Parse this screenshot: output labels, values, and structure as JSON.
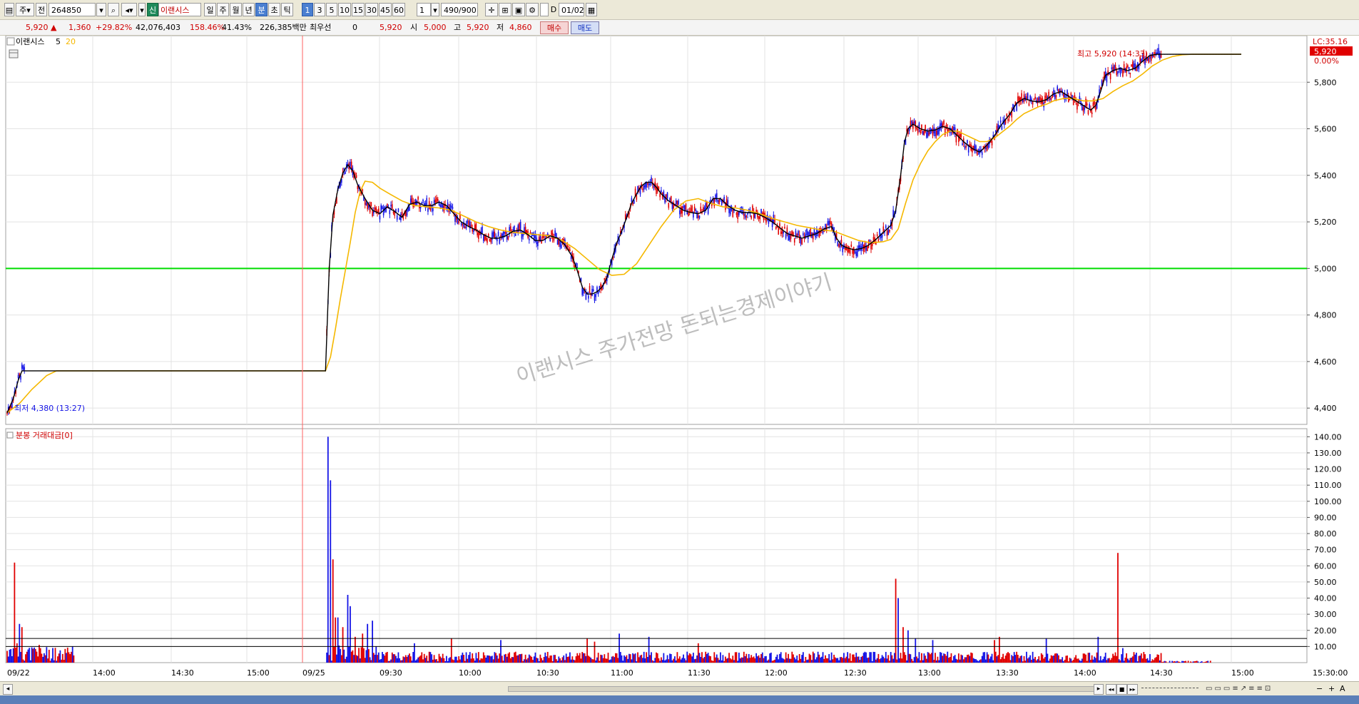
{
  "toolbar": {
    "market": "주",
    "market_mode": "전",
    "code": "264850",
    "badge": "신",
    "name": "이랜시스",
    "periods": [
      "일",
      "주",
      "월",
      "년",
      "분",
      "초",
      "틱"
    ],
    "active_period": "분",
    "intervals": [
      "1",
      "3",
      "5",
      "10",
      "15",
      "30",
      "45",
      "60"
    ],
    "active_interval": "1",
    "step": "1",
    "count": "490",
    "count_total": "900",
    "d_label": "D",
    "date": "01/02"
  },
  "quote": {
    "price": "5,920",
    "change": "1,360",
    "change_pct": "+29.82%",
    "volume": "42,076,403",
    "vol_ratio": "158.46%",
    "turnover": "41.43%",
    "amount": "226,385백만",
    "priority_label": "최우선",
    "priority_qty": "0",
    "priority_price": "5,920",
    "open_label": "시",
    "open": "5,000",
    "high_label": "고",
    "high": "5,920",
    "low_label": "저",
    "low": "4,860",
    "buy_label": "매수",
    "sell_label": "매도"
  },
  "chart_data": [
    {
      "type": "line",
      "legend": "이랜시스",
      "ma_periods": [
        "5",
        "20"
      ],
      "colors": {
        "ma5": "#000000",
        "ma20": "#f5b800",
        "up": "#e00000",
        "down": "#1414e6",
        "ref_line": "#00dd00"
      },
      "reference_line": 5000,
      "ylim": [
        4330,
        6000
      ],
      "yticks": [
        "4,400",
        "4,600",
        "4,800",
        "5,000",
        "5,200",
        "5,400",
        "5,600",
        "5,800"
      ],
      "x_labels": [
        "09/22",
        "14:00",
        "14:30",
        "15:00",
        "09/25",
        "09:30",
        "10:00",
        "10:30",
        "11:00",
        "11:30",
        "12:00",
        "12:30",
        "13:00",
        "13:30",
        "14:00",
        "14:30",
        "15:00",
        "15:30:00"
      ],
      "ma5": [
        [
          0,
          4380
        ],
        [
          5,
          4440
        ],
        [
          9,
          4520
        ],
        [
          12,
          4560
        ],
        [
          20,
          4560
        ],
        [
          40,
          4560
        ],
        [
          100,
          4560
        ],
        [
          180,
          4560
        ],
        [
          220,
          4560
        ],
        [
          258,
          4560
        ],
        [
          261,
          5000
        ],
        [
          264,
          5230
        ],
        [
          268,
          5340
        ],
        [
          272,
          5410
        ],
        [
          276,
          5445
        ],
        [
          280,
          5420
        ],
        [
          284,
          5360
        ],
        [
          290,
          5300
        ],
        [
          296,
          5250
        ],
        [
          302,
          5235
        ],
        [
          308,
          5265
        ],
        [
          314,
          5245
        ],
        [
          320,
          5220
        ],
        [
          326,
          5275
        ],
        [
          332,
          5285
        ],
        [
          338,
          5270
        ],
        [
          344,
          5270
        ],
        [
          350,
          5285
        ],
        [
          356,
          5270
        ],
        [
          362,
          5235
        ],
        [
          368,
          5200
        ],
        [
          374,
          5180
        ],
        [
          380,
          5165
        ],
        [
          386,
          5145
        ],
        [
          392,
          5130
        ],
        [
          398,
          5130
        ],
        [
          404,
          5140
        ],
        [
          410,
          5160
        ],
        [
          416,
          5165
        ],
        [
          422,
          5145
        ],
        [
          428,
          5120
        ],
        [
          434,
          5120
        ],
        [
          440,
          5140
        ],
        [
          446,
          5130
        ],
        [
          452,
          5100
        ],
        [
          458,
          5050
        ],
        [
          462,
          4990
        ],
        [
          466,
          4920
        ],
        [
          470,
          4890
        ],
        [
          474,
          4890
        ],
        [
          478,
          4900
        ],
        [
          482,
          4920
        ],
        [
          486,
          4960
        ],
        [
          490,
          5040
        ],
        [
          494,
          5110
        ],
        [
          498,
          5160
        ],
        [
          502,
          5220
        ],
        [
          506,
          5280
        ],
        [
          510,
          5320
        ],
        [
          514,
          5355
        ],
        [
          518,
          5370
        ],
        [
          522,
          5370
        ],
        [
          526,
          5350
        ],
        [
          530,
          5320
        ],
        [
          536,
          5290
        ],
        [
          542,
          5270
        ],
        [
          548,
          5250
        ],
        [
          554,
          5240
        ],
        [
          560,
          5235
        ],
        [
          566,
          5250
        ],
        [
          572,
          5300
        ],
        [
          578,
          5300
        ],
        [
          584,
          5270
        ],
        [
          590,
          5250
        ],
        [
          596,
          5240
        ],
        [
          602,
          5240
        ],
        [
          608,
          5235
        ],
        [
          614,
          5220
        ],
        [
          620,
          5200
        ],
        [
          626,
          5175
        ],
        [
          632,
          5150
        ],
        [
          638,
          5140
        ],
        [
          644,
          5130
        ],
        [
          650,
          5140
        ],
        [
          656,
          5150
        ],
        [
          662,
          5170
        ],
        [
          668,
          5180
        ],
        [
          672,
          5130
        ],
        [
          676,
          5100
        ],
        [
          680,
          5090
        ],
        [
          686,
          5080
        ],
        [
          692,
          5085
        ],
        [
          698,
          5100
        ],
        [
          704,
          5125
        ],
        [
          710,
          5155
        ],
        [
          716,
          5185
        ],
        [
          720,
          5250
        ],
        [
          724,
          5400
        ],
        [
          727,
          5540
        ],
        [
          730,
          5600
        ],
        [
          734,
          5620
        ],
        [
          740,
          5600
        ],
        [
          746,
          5590
        ],
        [
          752,
          5595
        ],
        [
          758,
          5610
        ],
        [
          764,
          5600
        ],
        [
          770,
          5570
        ],
        [
          776,
          5540
        ],
        [
          782,
          5515
        ],
        [
          788,
          5500
        ],
        [
          794,
          5530
        ],
        [
          800,
          5570
        ],
        [
          806,
          5620
        ],
        [
          812,
          5660
        ],
        [
          818,
          5710
        ],
        [
          824,
          5730
        ],
        [
          830,
          5720
        ],
        [
          836,
          5715
        ],
        [
          842,
          5725
        ],
        [
          848,
          5750
        ],
        [
          854,
          5760
        ],
        [
          860,
          5740
        ],
        [
          866,
          5720
        ],
        [
          872,
          5700
        ],
        [
          878,
          5680
        ],
        [
          882,
          5700
        ],
        [
          886,
          5760
        ],
        [
          890,
          5830
        ],
        [
          896,
          5850
        ],
        [
          902,
          5860
        ],
        [
          908,
          5850
        ],
        [
          914,
          5860
        ],
        [
          920,
          5890
        ],
        [
          926,
          5915
        ],
        [
          932,
          5920
        ],
        [
          960,
          5920
        ],
        [
          1000,
          5920
        ]
      ],
      "ma20": [
        [
          0,
          4380
        ],
        [
          10,
          4420
        ],
        [
          20,
          4480
        ],
        [
          32,
          4540
        ],
        [
          40,
          4560
        ],
        [
          100,
          4560
        ],
        [
          258,
          4560
        ],
        [
          262,
          4620
        ],
        [
          266,
          4740
        ],
        [
          270,
          4870
        ],
        [
          274,
          4990
        ],
        [
          278,
          5110
        ],
        [
          282,
          5240
        ],
        [
          286,
          5330
        ],
        [
          290,
          5375
        ],
        [
          296,
          5370
        ],
        [
          302,
          5345
        ],
        [
          310,
          5320
        ],
        [
          320,
          5290
        ],
        [
          330,
          5270
        ],
        [
          340,
          5265
        ],
        [
          350,
          5260
        ],
        [
          360,
          5250
        ],
        [
          370,
          5225
        ],
        [
          380,
          5200
        ],
        [
          390,
          5180
        ],
        [
          400,
          5165
        ],
        [
          410,
          5155
        ],
        [
          420,
          5150
        ],
        [
          430,
          5145
        ],
        [
          440,
          5140
        ],
        [
          450,
          5120
        ],
        [
          460,
          5085
        ],
        [
          470,
          5040
        ],
        [
          480,
          4995
        ],
        [
          490,
          4970
        ],
        [
          500,
          4975
        ],
        [
          510,
          5020
        ],
        [
          520,
          5100
        ],
        [
          530,
          5180
        ],
        [
          540,
          5250
        ],
        [
          550,
          5290
        ],
        [
          560,
          5300
        ],
        [
          570,
          5280
        ],
        [
          580,
          5265
        ],
        [
          590,
          5260
        ],
        [
          600,
          5250
        ],
        [
          610,
          5235
        ],
        [
          620,
          5215
        ],
        [
          630,
          5200
        ],
        [
          640,
          5185
        ],
        [
          650,
          5175
        ],
        [
          660,
          5165
        ],
        [
          670,
          5160
        ],
        [
          680,
          5140
        ],
        [
          690,
          5120
        ],
        [
          700,
          5110
        ],
        [
          710,
          5115
        ],
        [
          716,
          5125
        ],
        [
          722,
          5170
        ],
        [
          728,
          5280
        ],
        [
          734,
          5380
        ],
        [
          740,
          5450
        ],
        [
          746,
          5505
        ],
        [
          752,
          5545
        ],
        [
          758,
          5575
        ],
        [
          764,
          5590
        ],
        [
          770,
          5590
        ],
        [
          776,
          5575
        ],
        [
          782,
          5560
        ],
        [
          788,
          5545
        ],
        [
          794,
          5545
        ],
        [
          800,
          5560
        ],
        [
          806,
          5585
        ],
        [
          812,
          5610
        ],
        [
          818,
          5640
        ],
        [
          824,
          5665
        ],
        [
          830,
          5680
        ],
        [
          836,
          5695
        ],
        [
          842,
          5705
        ],
        [
          848,
          5720
        ],
        [
          856,
          5730
        ],
        [
          864,
          5730
        ],
        [
          872,
          5720
        ],
        [
          880,
          5720
        ],
        [
          888,
          5730
        ],
        [
          896,
          5760
        ],
        [
          904,
          5785
        ],
        [
          912,
          5805
        ],
        [
          920,
          5835
        ],
        [
          928,
          5870
        ],
        [
          936,
          5895
        ],
        [
          944,
          5910
        ],
        [
          952,
          5918
        ],
        [
          960,
          5920
        ],
        [
          1000,
          5920
        ]
      ],
      "high_note": "최고 5,920 (14:33)",
      "low_note": "최저 4,380 (13:27)",
      "right_top_label": "LC:35.16",
      "price_tag": "5,920",
      "price_tag_pct": "0.00%"
    },
    {
      "type": "bar",
      "legend": "분봉 거래대금[0]",
      "ylim": [
        0,
        145
      ],
      "yticks": [
        "10.00",
        "20.00",
        "30.00",
        "40.00",
        "50.00",
        "60.00",
        "70.00",
        "80.00",
        "90.00",
        "100.00",
        "110.00",
        "120.00",
        "130.00",
        "140.00"
      ],
      "guide_levels": [
        10,
        15
      ],
      "spikes": [
        [
          2,
          8
        ],
        [
          4,
          4
        ],
        [
          6,
          62
        ],
        [
          8,
          12
        ],
        [
          10,
          24
        ],
        [
          12,
          22
        ],
        [
          26,
          11
        ],
        [
          48,
          6
        ],
        [
          260,
          140
        ],
        [
          262,
          113
        ],
        [
          264,
          64
        ],
        [
          266,
          28
        ],
        [
          268,
          28
        ],
        [
          272,
          22
        ],
        [
          276,
          42
        ],
        [
          278,
          35
        ],
        [
          282,
          16
        ],
        [
          288,
          18
        ],
        [
          292,
          24
        ],
        [
          296,
          26
        ],
        [
          330,
          12
        ],
        [
          360,
          15
        ],
        [
          400,
          14
        ],
        [
          470,
          15
        ],
        [
          476,
          13
        ],
        [
          496,
          18
        ],
        [
          520,
          16
        ],
        [
          560,
          12
        ],
        [
          720,
          52
        ],
        [
          722,
          40
        ],
        [
          726,
          22
        ],
        [
          730,
          20
        ],
        [
          736,
          15
        ],
        [
          750,
          14
        ],
        [
          800,
          14
        ],
        [
          804,
          16
        ],
        [
          842,
          15
        ],
        [
          884,
          16
        ],
        [
          900,
          68
        ],
        [
          904,
          9
        ]
      ]
    }
  ],
  "watermark": "이랜시스 주가전망 돈되는경제이야기",
  "chart_icons": [
    "calendar-icon"
  ],
  "scroll": {
    "icons": [
      "scroll-left-icon",
      "play-prev-icon",
      "play-back-icon",
      "stop-icon",
      "play-next-icon",
      "zoom-out-icon",
      "zoom-in-icon"
    ],
    "zoom_label": "A"
  }
}
